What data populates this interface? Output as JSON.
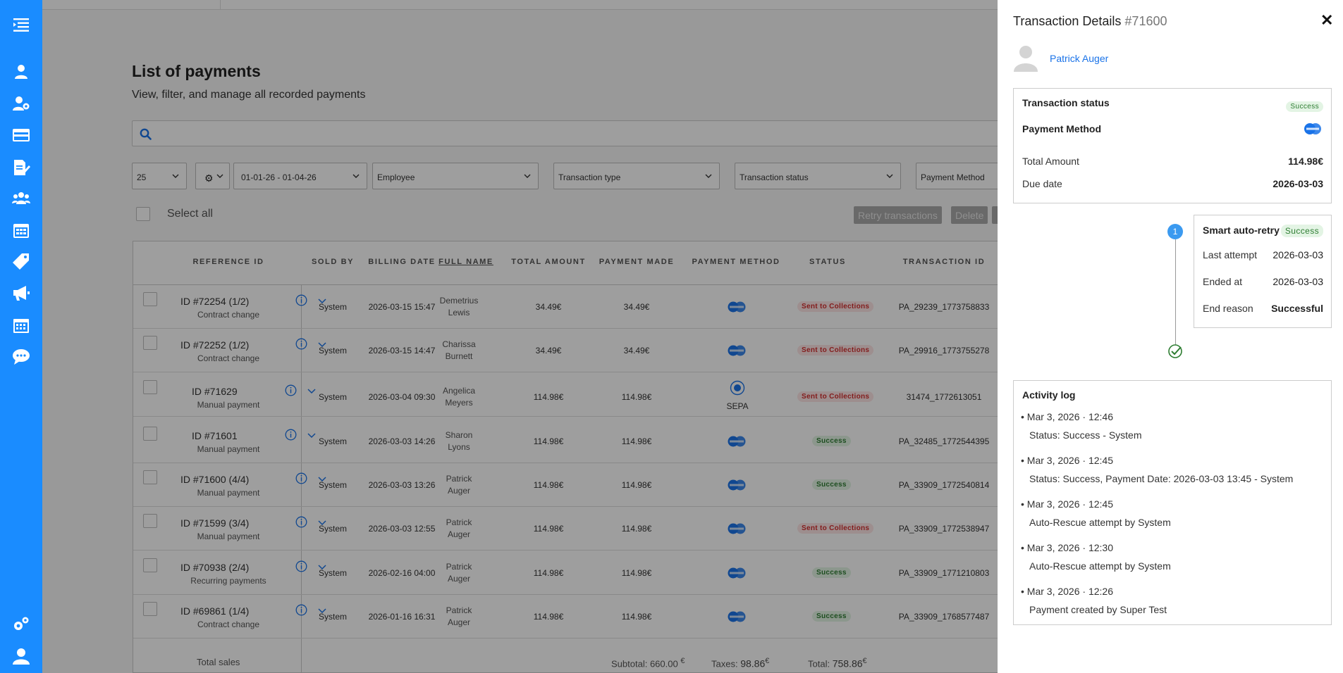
{
  "page": {
    "title": "List of payments",
    "subtitle": "View, filter, and manage all recorded payments"
  },
  "filters": {
    "page_size": "25",
    "date_range": "01-01-26 - 01-04-26",
    "employee": "Employee",
    "transaction_type": "Transaction type",
    "transaction_status": "Transaction status",
    "payment_method": "Payment Method"
  },
  "toolbar": {
    "select_all": "Select all",
    "retry": "Retry transactions",
    "delete": "Delete"
  },
  "table": {
    "headers": [
      "REFERENCE ID",
      "SOLD BY",
      "BILLING DATE",
      "FULL NAME",
      "TOTAL AMOUNT",
      "PAYMENT MADE",
      "PAYMENT METHOD",
      "STATUS",
      "TRANSACTION ID"
    ],
    "rows": [
      {
        "id": "ID #72254 (1/2)",
        "note": "Contract change",
        "sold_by": "System",
        "date": "2026-03-15 15:47",
        "name1": "Demetrius",
        "name2": "Lewis",
        "total": "34.49€",
        "paid": "34.49€",
        "method": "card",
        "method_label": "",
        "status": "Sent to Collections",
        "status_color": "red",
        "txn": "PA_29239_1773758833"
      },
      {
        "id": "ID #72252 (1/2)",
        "note": "Contract change",
        "sold_by": "System",
        "date": "2026-03-15 14:47",
        "name1": "Charissa",
        "name2": "Burnett",
        "total": "34.49€",
        "paid": "34.49€",
        "method": "card",
        "method_label": "",
        "status": "Sent to Collections",
        "status_color": "red",
        "txn": "PA_29916_1773755278"
      },
      {
        "id": "ID #71629",
        "note": "Manual payment",
        "sold_by": "System",
        "date": "2026-03-04 09:30",
        "name1": "Angelica",
        "name2": "Meyers",
        "total": "114.98€",
        "paid": "114.98€",
        "method": "sepa",
        "method_label": "SEPA",
        "status": "Sent to Collections",
        "status_color": "red",
        "txn": "31474_1772613051"
      },
      {
        "id": "ID #71601",
        "note": "Manual payment",
        "sold_by": "System",
        "date": "2026-03-03 14:26",
        "name1": "Sharon",
        "name2": "Lyons",
        "total": "114.98€",
        "paid": "114.98€",
        "method": "card",
        "method_label": "",
        "status": "Success",
        "status_color": "green",
        "txn": "PA_32485_1772544395"
      },
      {
        "id": "ID #71600 (4/4)",
        "note": "Manual payment",
        "sold_by": "System",
        "date": "2026-03-03 13:26",
        "name1": "Patrick",
        "name2": "Auger",
        "total": "114.98€",
        "paid": "114.98€",
        "method": "card",
        "method_label": "",
        "status": "Success",
        "status_color": "green",
        "txn": "PA_33909_1772540814"
      },
      {
        "id": "ID #71599 (3/4)",
        "note": "Manual payment",
        "sold_by": "System",
        "date": "2026-03-03 12:55",
        "name1": "Patrick",
        "name2": "Auger",
        "total": "114.98€",
        "paid": "114.98€",
        "method": "card",
        "method_label": "",
        "status": "Sent to Collections",
        "status_color": "red",
        "txn": "PA_33909_1772538947"
      },
      {
        "id": "ID #70938 (2/4)",
        "note": "Recurring payments",
        "sold_by": "System",
        "date": "2026-02-16 04:00",
        "name1": "Patrick",
        "name2": "Auger",
        "total": "114.98€",
        "paid": "114.98€",
        "method": "card",
        "method_label": "",
        "status": "Success",
        "status_color": "green",
        "txn": "PA_33909_1771210803"
      },
      {
        "id": "ID #69861 (1/4)",
        "note": "Contract change",
        "sold_by": "System",
        "date": "2026-01-16 16:31",
        "name1": "Patrick",
        "name2": "Auger",
        "total": "114.98€",
        "paid": "114.98€",
        "method": "card",
        "method_label": "",
        "status": "Success",
        "status_color": "green",
        "txn": "PA_33909_1768577487"
      }
    ],
    "totals": {
      "label": "Total sales",
      "subtotal_label": "Subtotal:",
      "subtotal": "660.00",
      "taxes_label": "Taxes:",
      "taxes": "98.86",
      "total_label": "Total:",
      "total": "758.86",
      "currency": "€"
    }
  },
  "panel": {
    "title": "Transaction Details",
    "number": "#71600",
    "customer": "Patrick Auger",
    "status_card": {
      "status_label": "Transaction status",
      "status_value": "Success",
      "method_label": "Payment Method",
      "amount_label": "Total Amount",
      "amount_value": "114.98€",
      "due_label": "Due date",
      "due_value": "2026-03-03"
    },
    "retry": {
      "step": "1",
      "title": "Smart auto-retry",
      "badge": "Success",
      "last_attempt_label": "Last attempt",
      "last_attempt_value": "2026-03-03",
      "ended_label": "Ended at",
      "ended_value": "2026-03-03",
      "reason_label": "End reason",
      "reason_value": "Successful"
    },
    "activity": {
      "title": "Activity log",
      "items": [
        {
          "when": "Mar 3, 2026 · 12:46",
          "what": "Status: Success - System"
        },
        {
          "when": "Mar 3, 2026 · 12:45",
          "what": "Status: Success, Payment Date: 2026-03-03 13:45 - System"
        },
        {
          "when": "Mar 3, 2026 · 12:45",
          "what": "Auto-Rescue attempt by System"
        },
        {
          "when": "Mar 3, 2026 · 12:30",
          "what": "Auto-Rescue attempt by System"
        },
        {
          "when": "Mar 3, 2026 · 12:26",
          "what": "Payment created by Super Test"
        }
      ]
    }
  },
  "colors": {
    "sidebar": "#1a8cff",
    "link": "#1a73e8",
    "success": "#2e7d32",
    "danger": "#d32f2f"
  },
  "icons": [
    "menu-icon",
    "user-icon",
    "user-settings-icon",
    "credit-card-icon",
    "document-edit-icon",
    "group-icon",
    "calendar-icon",
    "tag-icon",
    "megaphone-icon",
    "calendar-grid-icon",
    "chat-icon",
    "settings-icon",
    "profile-icon"
  ]
}
